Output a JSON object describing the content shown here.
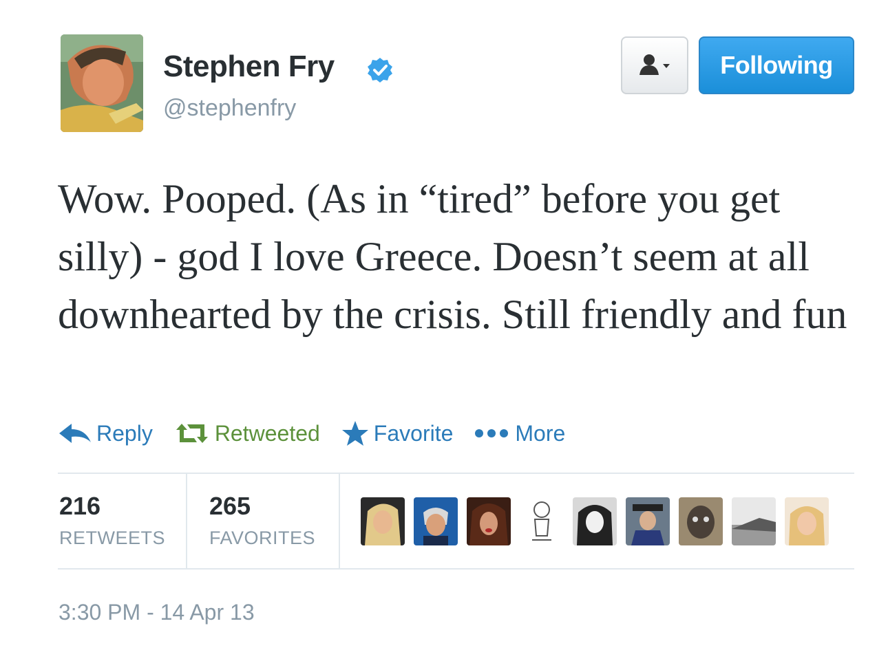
{
  "user": {
    "display_name": "Stephen Fry",
    "handle": "@stephenfry",
    "verified": true,
    "avatar_icon": "profile-photo"
  },
  "buttons": {
    "user_actions_icon": "person-dropdown-icon",
    "follow_label": "Following",
    "follow_color": "#1b8fd9"
  },
  "tweet": {
    "text": "Wow. Pooped. (As in “tired” before you get silly) - god I love Greece. Doesn’t seem at all downhearted by the crisis. Still friendly and fun"
  },
  "actions": [
    {
      "label": "Reply",
      "icon": "reply-arrow-icon",
      "color": "#2b7bb9"
    },
    {
      "label": "Retweeted",
      "icon": "retweet-icon",
      "color": "#5c913b"
    },
    {
      "label": "Favorite",
      "icon": "star-icon",
      "color": "#2b7bb9"
    },
    {
      "label": "More",
      "icon": "ellipsis-icon",
      "color": "#2b7bb9"
    }
  ],
  "stats": {
    "retweets": {
      "count": "216",
      "label": "RETWEETS"
    },
    "favorites": {
      "count": "265",
      "label": "FAVORITES"
    }
  },
  "favoriters_count_shown": 9,
  "timestamp": "3:30 PM - 14 Apr 13"
}
